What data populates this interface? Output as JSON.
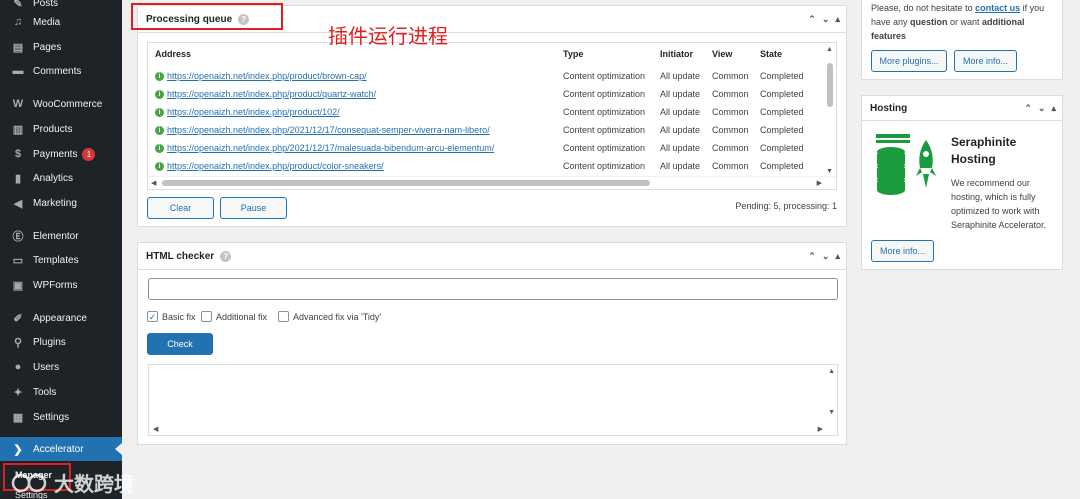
{
  "sidebar": {
    "items": [
      {
        "label": "Posts",
        "icon": "pin-icon"
      },
      {
        "label": "Media",
        "icon": "media-icon"
      },
      {
        "label": "Pages",
        "icon": "pages-icon"
      },
      {
        "label": "Comments",
        "icon": "comment-icon"
      },
      {
        "label": "WooCommerce",
        "icon": "woo-icon"
      },
      {
        "label": "Products",
        "icon": "box-icon"
      },
      {
        "label": "Payments",
        "icon": "dollar-icon",
        "badge": "1"
      },
      {
        "label": "Analytics",
        "icon": "bar-chart-icon"
      },
      {
        "label": "Marketing",
        "icon": "megaphone-icon"
      },
      {
        "label": "Elementor",
        "icon": "elementor-icon"
      },
      {
        "label": "Templates",
        "icon": "folder-icon"
      },
      {
        "label": "WPForms",
        "icon": "forms-icon"
      },
      {
        "label": "Appearance",
        "icon": "brush-icon"
      },
      {
        "label": "Plugins",
        "icon": "plug-icon"
      },
      {
        "label": "Users",
        "icon": "user-icon"
      },
      {
        "label": "Tools",
        "icon": "wrench-icon"
      },
      {
        "label": "Settings",
        "icon": "settings-icon"
      },
      {
        "label": "Accelerator",
        "icon": "accelerator-icon"
      }
    ],
    "sub1": "Manager",
    "sub2": "Settings"
  },
  "annotation": "插件运行进程",
  "watermark": "大数跨境",
  "queue": {
    "title": "Processing queue",
    "columns": [
      "Address",
      "Type",
      "Initiator",
      "View",
      "State"
    ],
    "rows": [
      {
        "address": "https://openaizh.net/index.php/product/brown-cap/",
        "type": "Content optimization",
        "initiator": "All update",
        "view": "Common",
        "state": "Completed"
      },
      {
        "address": "https://openaizh.net/index.php/product/quartz-watch/",
        "type": "Content optimization",
        "initiator": "All update",
        "view": "Common",
        "state": "Completed"
      },
      {
        "address": "https://openaizh.net/index.php/product/102/",
        "type": "Content optimization",
        "initiator": "All update",
        "view": "Common",
        "state": "Completed"
      },
      {
        "address": "https://openaizh.net/index.php/2021/12/17/consequat-semper-viverra-nam-libero/",
        "type": "Content optimization",
        "initiator": "All update",
        "view": "Common",
        "state": "Completed"
      },
      {
        "address": "https://openaizh.net/index.php/2021/12/17/malesuada-bibendum-arcu-elementum/",
        "type": "Content optimization",
        "initiator": "All update",
        "view": "Common",
        "state": "Completed"
      },
      {
        "address": "https://openaizh.net/index.php/product/color-sneakers/",
        "type": "Content optimization",
        "initiator": "All update",
        "view": "Common",
        "state": "Completed"
      }
    ],
    "clear_label": "Clear",
    "pause_label": "Pause",
    "status": "Pending: 5, processing: 1"
  },
  "checker": {
    "title": "HTML checker",
    "input_value": "",
    "basic_fix": "Basic fix",
    "additional_fix": "Additional fix",
    "advanced_fix": "Advanced fix via 'Tidy'",
    "check_label": "Check"
  },
  "support": {
    "text_prefix": "Please, do not hesitate to ",
    "contact": "contact us",
    "text_mid": " if you have any ",
    "question": "question",
    "text_or": " or want ",
    "additional": "additional",
    "features": "features",
    "more_plugins": "More plugins...",
    "more_info": "More info..."
  },
  "hosting": {
    "title": "Hosting",
    "brand": "Seraphinite Hosting",
    "desc": "We recommend our hosting, which is fully optimized to work with Seraphinite Accelerator.",
    "more_info": "More info..."
  },
  "colors": {
    "accent": "#2271b1",
    "sidebar": "#1d2327",
    "success": "#46a546",
    "annotation": "#e02020",
    "hosting_green": "#1a9c3e"
  }
}
